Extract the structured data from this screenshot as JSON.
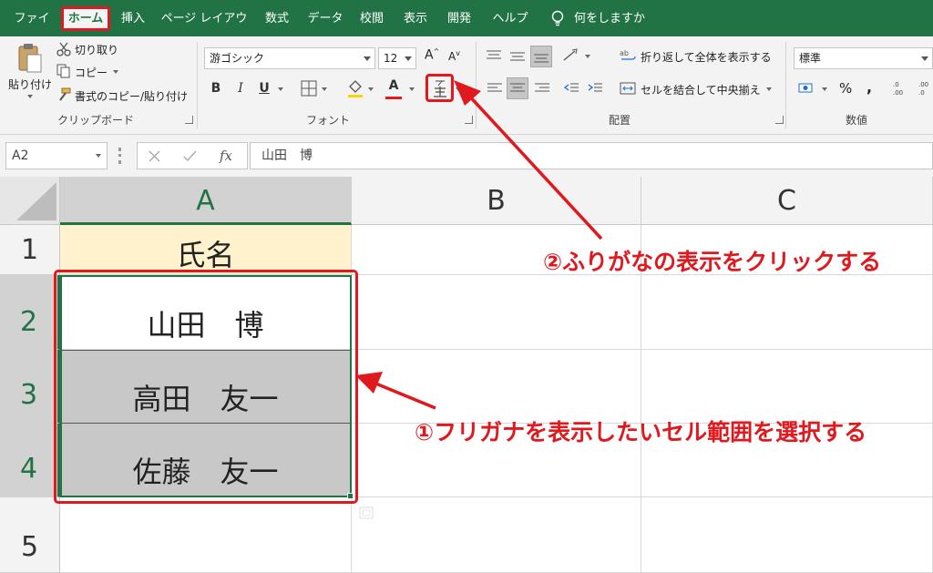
{
  "menu": {
    "tabs": [
      "ファイル",
      "ホーム",
      "挿入",
      "ページ レイアウト",
      "数式",
      "データ",
      "校閲",
      "表示",
      "開発",
      "ヘルプ"
    ],
    "tell_me": "何をしますか"
  },
  "ribbon": {
    "clipboard": {
      "paste": "貼り付け",
      "cut": "切り取り",
      "copy": "コピー",
      "format_painter": "書式のコピー/貼り付け",
      "label": "クリップボード"
    },
    "font": {
      "font_name": "游ゴシック",
      "font_size": "12",
      "bold": "B",
      "italic": "I",
      "underline": "U",
      "font_color_glyph": "A",
      "label": "フォント"
    },
    "alignment": {
      "wrap_text": "折り返して全体を表示する",
      "merge_center": "セルを結合して中央揃え",
      "label": "配置"
    },
    "number": {
      "format": "標準",
      "percent": "%",
      "comma": ",",
      "label": "数値"
    }
  },
  "formula_bar": {
    "name_box": "A2",
    "fx": "fx",
    "content": "山田　博"
  },
  "grid": {
    "columns": [
      "A",
      "B",
      "C"
    ],
    "rows": [
      "1",
      "2",
      "3",
      "4",
      "5"
    ],
    "cells": {
      "a1": "氏名",
      "a2": "山田　博",
      "a3": "高田　友一",
      "a4": "佐藤　友一"
    }
  },
  "annotations": {
    "step1": "①フリガナを表示したいセル範囲を選択する",
    "step2": "②ふりがなの表示をクリックする"
  },
  "colors": {
    "excel_green": "#217346",
    "highlight_red": "#e0191e",
    "header_fill": "#fff2cc",
    "selection_fill": "#c8c8c8"
  }
}
